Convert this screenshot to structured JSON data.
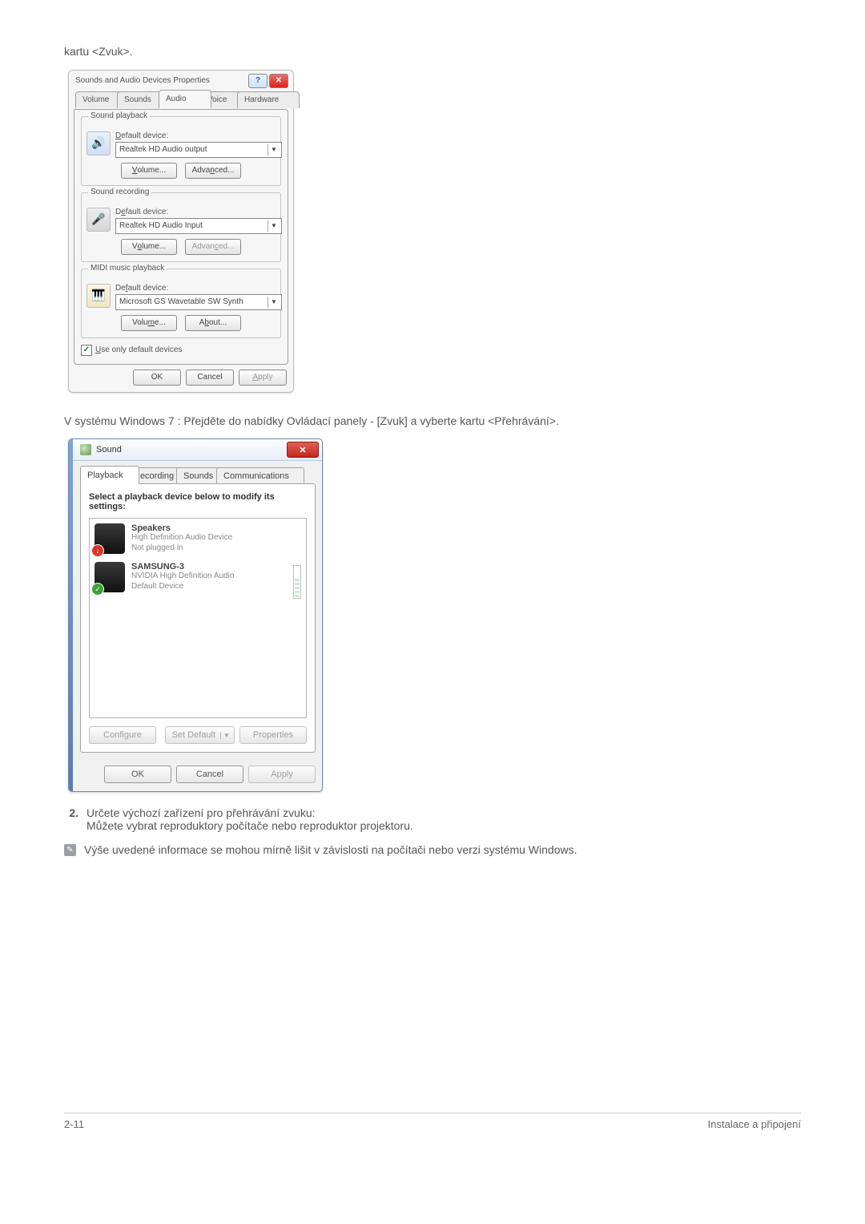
{
  "intro_text": "kartu <Zvuk>.",
  "xp": {
    "title": "Sounds and Audio Devices Properties",
    "help_glyph": "?",
    "close_glyph": "✕",
    "tabs": {
      "volume": "Volume",
      "sounds": "Sounds",
      "audio": "Audio",
      "voice": "Voice",
      "hardware": "Hardware"
    },
    "playback": {
      "legend": "Sound playback",
      "label_pre": "D",
      "label_post": "efault device:",
      "device": "Realtek HD Audio output",
      "volume_pre": "V",
      "volume_post": "olume...",
      "adv_pre": "Adva",
      "adv_mid": "n",
      "adv_post": "ced..."
    },
    "recording": {
      "legend": "Sound recording",
      "label_pre": "D",
      "label_mid": "e",
      "label_post": "fault device:",
      "device": "Realtek HD Audio Input",
      "vol_pre": "V",
      "vol_mid": "o",
      "vol_post": "lume...",
      "adv_pre": "Advan",
      "adv_mid": "c",
      "adv_post": "ed..."
    },
    "midi": {
      "legend": "MIDI music playback",
      "label_pre": "De",
      "label_mid": "f",
      "label_post": "ault device:",
      "device": "Microsoft GS Wavetable SW Synth",
      "vol_pre": "Volu",
      "vol_mid": "m",
      "vol_post": "e...",
      "about_pre": "A",
      "about_mid": "b",
      "about_post": "out..."
    },
    "useonly_pre": "U",
    "useonly_post": "se only default devices",
    "check_glyph": "✓",
    "ok": "OK",
    "cancel": "Cancel",
    "apply_pre": "A",
    "apply_post": "pply"
  },
  "win7_intro": "V systému Windows 7 : Přejděte do nabídky Ovládací panely - [Zvuk] a vyberte kartu <Přehrávání>.",
  "w7": {
    "title": "Sound",
    "close_glyph": "✕",
    "tabs": {
      "playback": "Playback",
      "recording": "Recording",
      "sounds": "Sounds",
      "comm": "Communications"
    },
    "instruction": "Select a playback device below to modify its settings:",
    "items": [
      {
        "title": "Speakers",
        "sub1": "High Definition Audio Device",
        "sub2": "Not plugged in",
        "badge": "red",
        "badge_glyph": "↓"
      },
      {
        "title": "SAMSUNG-3",
        "sub1": "NVIDIA High Definition Audio",
        "sub2": "Default Device",
        "badge": "green",
        "badge_glyph": "✓"
      }
    ],
    "configure": "Configure",
    "set_default": "Set Default",
    "properties": "Properties",
    "ok": "OK",
    "cancel": "Cancel",
    "apply": "Apply"
  },
  "step2": {
    "num": "2.",
    "line1": "Určete výchozí zařízení pro přehrávání zvuku:",
    "line2": "Můžete vybrat reproduktory počítače nebo reproduktor projektoru."
  },
  "note": "Výše uvedené informace se mohou mírně lišit v závislosti na počítači nebo verzi systému Windows.",
  "footer": {
    "left": "2-11",
    "right": "Instalace a připojení"
  }
}
